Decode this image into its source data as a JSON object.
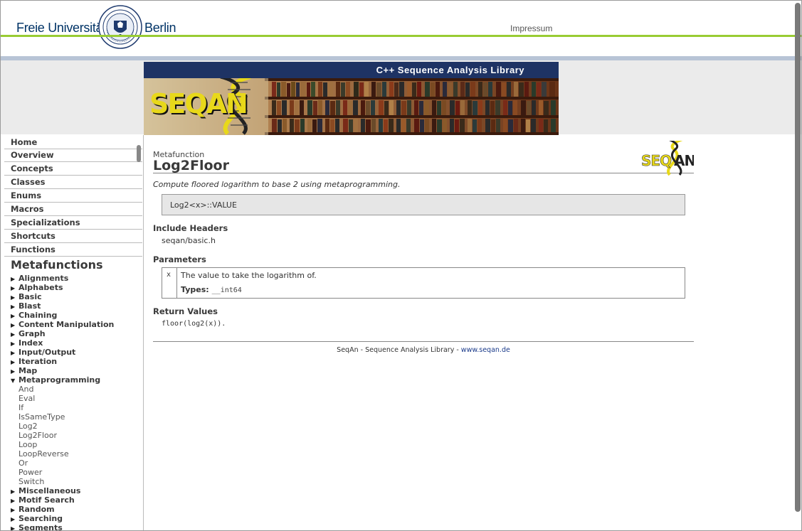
{
  "header": {
    "fu_left": "Freie Universität",
    "fu_right": "Berlin",
    "impressum": "Impressum"
  },
  "banner": {
    "tagline": "C++ Sequence Analysis Library",
    "logo_text": "SEQAN"
  },
  "sidebar": {
    "nav": [
      "Home",
      "Overview",
      "Concepts",
      "Classes",
      "Enums",
      "Macros",
      "Specializations",
      "Shortcuts",
      "Functions"
    ],
    "section_title": "Metafunctions",
    "categories_top": [
      "Alignments",
      "Alphabets",
      "Basic",
      "Blast",
      "Chaining",
      "Content Manipulation",
      "Graph",
      "Index",
      "Input/Output",
      "Iteration",
      "Map"
    ],
    "expanded": "Metaprogramming",
    "leaves": [
      "And",
      "Eval",
      "If",
      "IsSameType",
      "Log2",
      "Log2Floor",
      "Loop",
      "LoopReverse",
      "Or",
      "Power",
      "Switch"
    ],
    "categories_bottom": [
      "Miscellaneous",
      "Motif Search",
      "Random",
      "Searching",
      "Segments"
    ]
  },
  "main": {
    "kind": "Metafunction",
    "title": "Log2Floor",
    "summary": "Compute floored logarithm to base 2 using metaprogramming.",
    "signature": "Log2<x>::VALUE",
    "include_heading": "Include Headers",
    "include": "seqan/basic.h",
    "params_heading": "Parameters",
    "param_name": "x",
    "param_desc": "The value to take the logarithm of.",
    "types_label": "Types:",
    "types_value": "__int64",
    "return_heading": "Return Values",
    "return_value": "floor(log2(x)).",
    "footer_text": "SeqAn - Sequence Analysis Library - ",
    "footer_link": "www.seqan.de"
  },
  "colors": {
    "brand_blue": "#1e3364",
    "accent_green": "#99cc33",
    "logo_yellow": "#e8d81a"
  }
}
